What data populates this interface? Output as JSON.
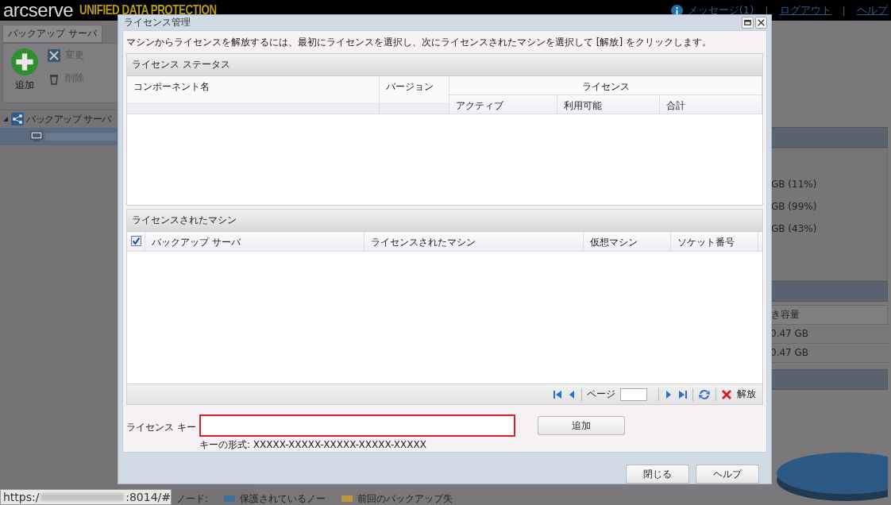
{
  "app": {
    "logo": "arcserve",
    "tagline": "UNIFIED DATA PROTECTION",
    "link_separator": "|",
    "header_links": [
      {
        "label": "メッセージ(1)",
        "kind": "message"
      },
      {
        "label": "ログアウト",
        "kind": "link"
      },
      {
        "label": "ヘルプ",
        "kind": "link"
      }
    ],
    "toolbar": {
      "tab": "バックアップ サーバ",
      "buttons": [
        {
          "label": "追加",
          "kind": "add",
          "disabled": false
        },
        {
          "label": "変更",
          "kind": "edit",
          "disabled": true
        },
        {
          "label": "削除",
          "kind": "delete",
          "disabled": true
        }
      ]
    },
    "tree": {
      "label": "バックアップ サーバ",
      "expanded": true
    },
    "right_panel": {
      "usage": [
        "GB (11%)",
        "GB (99%)",
        "GB (43%)"
      ],
      "column_header": "き容量",
      "rows": [
        "0.47 GB",
        "0.47 GB"
      ]
    },
    "legend": {
      "label": "ノード:",
      "items": [
        {
          "label": "保護されているノー",
          "color": "#3f6f95"
        },
        {
          "label": "前回のバックアップ失",
          "color": "#b89a3c"
        }
      ]
    },
    "status_url": {
      "start": "https:/",
      "end": ":8014/#"
    }
  },
  "dialog": {
    "title": "ライセンス管理",
    "instruction": "マシンからライセンスを解放するには、最初にライセンスを選択し、次にライセンスされたマシンを選択して [解放] をクリックします。",
    "status_panel": {
      "title": "ライセンス ステータス",
      "columns": [
        "コンポーネント名",
        "バージョン"
      ],
      "group": "ライセンス",
      "subcolumns": [
        "アクティブ",
        "利用可能",
        "合計"
      ]
    },
    "machines_panel": {
      "title": "ライセンスされたマシン",
      "select_all_checked": true,
      "columns": [
        "バックアップ サーバ",
        "ライセンスされたマシン",
        "仮想マシン",
        "ソケット番号"
      ]
    },
    "pager": {
      "page_label": "ページ",
      "release": "解放"
    },
    "license_key": {
      "label": "ライセンス キー",
      "hint": "キーの形式: XXXXX-XXXXX-XXXXX-XXXXX-XXXXX",
      "invalid": true
    },
    "add_button": "追加",
    "buttons": [
      "閉じる",
      "ヘルプ"
    ]
  }
}
